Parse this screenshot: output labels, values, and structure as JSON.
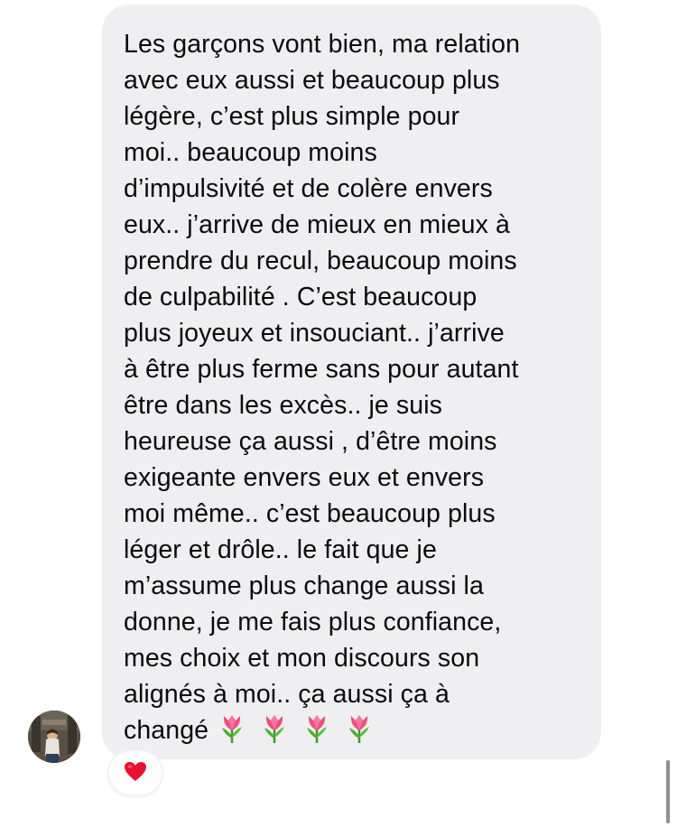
{
  "conversation": {
    "message": {
      "text": "Les garçons vont bien, ma relation\navec eux aussi et beaucoup plus\nlégère, c’est plus simple pour\nmoi.. beaucoup moins\nd’impulsivité et de colère envers\neux.. j’arrive de mieux en mieux à\nprendre du recul, beaucoup moins\nde culpabilité . C’est beaucoup\nplus joyeux et insouciant.. j’arrive\nà être plus ferme sans pour autant\nêtre dans les excès.. je suis\nheureuse ça aussi , d’être moins\nexigeante envers eux et envers\nmoi même.. c’est beaucoup plus\nléger et drôle.. le fait que je\nm’assume plus change aussi la\ndonne, je me fais plus confiance,\nmes choix et mon discours son\nalignés à moi..  ça aussi ça à\nchangé",
      "emojis": [
        "tulip-icon",
        "tulip-icon",
        "tulip-icon",
        "tulip-icon"
      ],
      "reaction": "heart-icon"
    },
    "colors": {
      "bubble_background": "#efeff1",
      "text": "#0b0b0c",
      "heart": "#e8112d"
    }
  }
}
